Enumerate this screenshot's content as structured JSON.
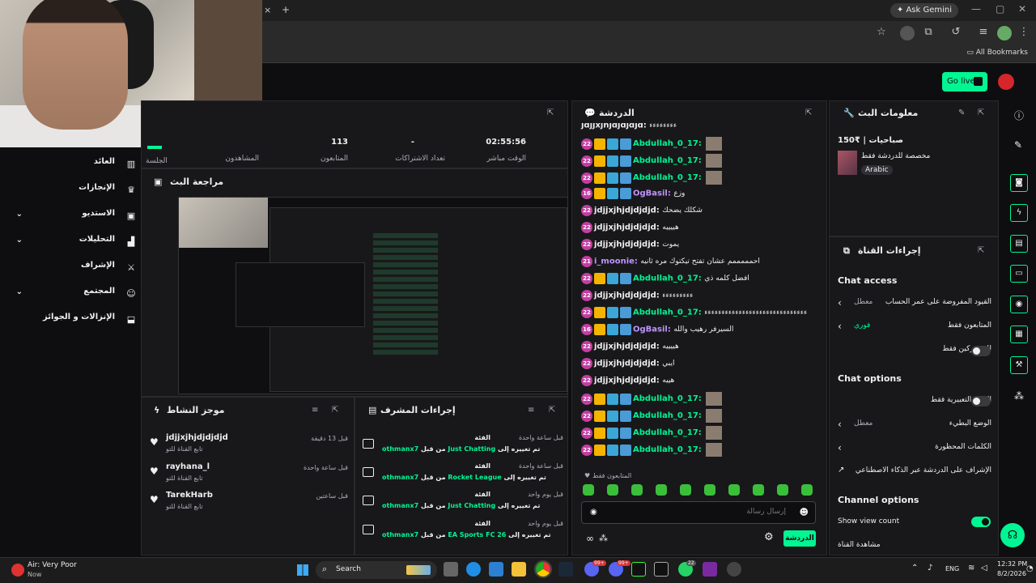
{
  "browser": {
    "ask_gemini": "Ask Gemini",
    "all_bookmarks": "All Bookmarks",
    "tab_close": "×",
    "new_tab": "+"
  },
  "header": {
    "go_live": "Go live",
    "accent": "#00f593"
  },
  "nav": {
    "items": [
      {
        "label": "العائد",
        "icon": "chart-bar-icon"
      },
      {
        "label": "الإنجازات",
        "icon": "trophy-icon"
      },
      {
        "label": "الاستديو",
        "icon": "studio-icon",
        "chevron": "⌄"
      },
      {
        "label": "التحليلات",
        "icon": "analytics-icon",
        "chevron": "⌄"
      },
      {
        "label": "الإشراف",
        "icon": "sword-icon"
      },
      {
        "label": "المجتمع",
        "icon": "community-icon",
        "chevron": "⌄"
      },
      {
        "label": "الإنزالات و الجوائز",
        "icon": "drops-icon"
      }
    ]
  },
  "stats": {
    "session_label": "الجلسة",
    "viewers_label": "المشاهدون",
    "followers_value": "113",
    "followers_label": "المتابعون",
    "subs_value": "-",
    "subs_label": "تعداد الاشتراكات",
    "live_value": "02:55:56",
    "live_label": "الوقت مباشر"
  },
  "stream_review": {
    "title": "مراجعة البث"
  },
  "activity": {
    "title": "موجز النشاط",
    "items": [
      {
        "name": "jdjjxjhjdjdjdjd",
        "sub": "تابع القناة للتو",
        "time": "قبل 13 دقيقة"
      },
      {
        "name": "rayhana_l",
        "sub": "تابع القناة للتو",
        "time": "قبل ساعة واحدة"
      },
      {
        "name": "TarekHarb",
        "sub": "تابع القناة للتو",
        "time": "قبل ساعتين"
      }
    ]
  },
  "mod_actions": {
    "title": "إجراءات المشرف",
    "items": [
      {
        "type": "الفئة",
        "user": "othmanx7",
        "by": "من قبل",
        "change": "تم تغييره إلى",
        "value": "Just Chatting",
        "time": "قبل ساعة واحدة"
      },
      {
        "type": "الفئة",
        "user": "othmanx7",
        "by": "من قبل",
        "change": "تم تغييره إلى",
        "value": "Rocket League",
        "time": "قبل ساعة واحدة"
      },
      {
        "type": "الفئة",
        "user": "othmanx7",
        "by": "من قبل",
        "change": "تم تغييره إلى",
        "value": "Just Chatting",
        "time": "قبل يوم واحد"
      },
      {
        "type": "الفئة",
        "user": "othmanx7",
        "by": "من قبل",
        "change": "تم تغييره إلى",
        "value": "EA Sports FC 26",
        "time": "قبل يوم واحد"
      }
    ]
  },
  "chat": {
    "title": "الدردشة",
    "messages": [
      {
        "badge": "",
        "name": "jdjjxjhjdjdjdjd:",
        "text": "ءءءءءءءء",
        "color": "#efeff1",
        "icons": false
      },
      {
        "badge": "22",
        "name": "Abdullah_0_17:",
        "text": "",
        "color": "#00f593",
        "icons": true,
        "avatar": true
      },
      {
        "badge": "22",
        "name": "Abdullah_0_17:",
        "text": "",
        "color": "#00f593",
        "icons": true,
        "avatar": true
      },
      {
        "badge": "22",
        "name": "Abdullah_0_17:",
        "text": "",
        "color": "#00f593",
        "icons": true,
        "avatar": true
      },
      {
        "badge": "16",
        "name": "OgBasil:",
        "text": "وزع",
        "color": "#bf94ff",
        "icons": true
      },
      {
        "badge": "22",
        "name": "jdjjxjhjdjdjdjd:",
        "text": "شكلك يضحك",
        "color": "#efeff1",
        "icons": false
      },
      {
        "badge": "22",
        "name": "jdjjxjhjdjdjdjd:",
        "text": "هييييه",
        "color": "#efeff1",
        "icons": false
      },
      {
        "badge": "22",
        "name": "jdjjxjhjdjdjdjd:",
        "text": "يموت",
        "color": "#efeff1",
        "icons": false
      },
      {
        "badge": "21",
        "name": "i_moonie:",
        "text": "احمممممم عشان تفتح تيكتوك مره ثانيه",
        "color": "#bf94ff",
        "icons": false
      },
      {
        "badge": "22",
        "name": "Abdullah_0_17:",
        "text": "افضل كلمه ذي",
        "color": "#00f593",
        "icons": true
      },
      {
        "badge": "22",
        "name": "jdjjxjhjdjdjdjd:",
        "text": "ءءءءءءءءء",
        "color": "#efeff1",
        "icons": false
      },
      {
        "badge": "22",
        "name": "Abdullah_0_17:",
        "text": "ءءءءءءءءءءءءءءءءءءءءءءءءءءءءءء",
        "color": "#00f593",
        "icons": true
      },
      {
        "badge": "16",
        "name": "OgBasil:",
        "text": "السيرفر رهيب والله",
        "color": "#bf94ff",
        "icons": true
      },
      {
        "badge": "22",
        "name": "jdjjxjhjdjdjdjd:",
        "text": "هييييه",
        "color": "#efeff1",
        "icons": false
      },
      {
        "badge": "22",
        "name": "jdjjxjhjdjdjdjd:",
        "text": "ايبي",
        "color": "#efeff1",
        "icons": false
      },
      {
        "badge": "22",
        "name": "jdjjxjhjdjdjdjd:",
        "text": "هييه",
        "color": "#efeff1",
        "icons": false
      },
      {
        "badge": "22",
        "name": "Abdullah_0_17:",
        "text": "",
        "color": "#00f593",
        "icons": true,
        "avatar": true
      },
      {
        "badge": "22",
        "name": "Abdullah_0_17:",
        "text": "",
        "color": "#00f593",
        "icons": true,
        "avatar": true
      },
      {
        "badge": "22",
        "name": "Abdullah_0_17:",
        "text": "",
        "color": "#00f593",
        "icons": true,
        "avatar": true
      },
      {
        "badge": "22",
        "name": "Abdullah_0_17:",
        "text": "",
        "color": "#00f593",
        "icons": true,
        "avatar": true
      }
    ],
    "followers_only": "المتابعون فقط",
    "input_placeholder": "إرسال رسالة",
    "send_label": "الدردشة"
  },
  "stream_info": {
    "title": "معلومات البث",
    "stream_title": "صباحيات | ₹150",
    "category": "مخصصة للدردشة فقط",
    "language": "Arabic"
  },
  "channel_actions": {
    "title": "إجراءات القناة",
    "chat_access_heading": "Chat access",
    "rows_access": [
      {
        "label": "القيود المفروضة على عمر الحساب",
        "value": "معطل",
        "arrow": "›"
      },
      {
        "label": "المتابعون فقط",
        "value": "فوري",
        "arrow": "›"
      },
      {
        "label": "للمشتركين فقط",
        "value": "",
        "toggle": false
      }
    ],
    "chat_options_heading": "Chat options",
    "rows_options": [
      {
        "label": "الصور التعبيرية فقط",
        "value": "",
        "toggle": false
      },
      {
        "label": "الوضع البطيء",
        "value": "معطل",
        "arrow": "›"
      },
      {
        "label": "الكلمات المحظورة",
        "value": "",
        "arrow": "›"
      },
      {
        "label": "الإشراف على الدردشة عبر الذكاء الاصطناعي",
        "value": "",
        "arrow": "↗"
      }
    ],
    "channel_options_heading": "Channel options",
    "show_view_count": "Show view count",
    "watch_channel": "مشاهدة القناة"
  },
  "taskbar": {
    "weather": "Air: Very Poor",
    "weather_sub": "Now",
    "search": "Search",
    "lang": "ENG",
    "time": "12:32 PM",
    "date": "8/2/2026",
    "badge_count_1": "99+",
    "badge_count_2": "99+",
    "badge_count_3": "22"
  }
}
